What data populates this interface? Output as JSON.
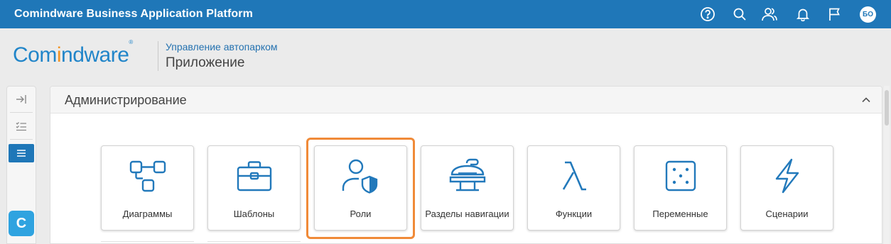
{
  "topbar": {
    "title": "Comindware Business Application Platform",
    "avatar_initials": "БО"
  },
  "header": {
    "logo_part1": "Com",
    "logo_part2": "i",
    "logo_part3": "ndware",
    "logo_mark": "®",
    "breadcrumb_link": "Управление автопарком",
    "page_title": "Приложение"
  },
  "sidebar": {
    "logo_letter": "C"
  },
  "panel": {
    "title": "Администрирование"
  },
  "tiles": [
    {
      "label": "Диаграммы"
    },
    {
      "label": "Шаблоны"
    },
    {
      "label": "Роли"
    },
    {
      "label": "Разделы навигации"
    },
    {
      "label": "Функции"
    },
    {
      "label": "Переменные"
    },
    {
      "label": "Сценарии"
    }
  ],
  "colors": {
    "brand": "#1f77b8",
    "icon": "#2279bb",
    "highlight": "#f08a38"
  }
}
